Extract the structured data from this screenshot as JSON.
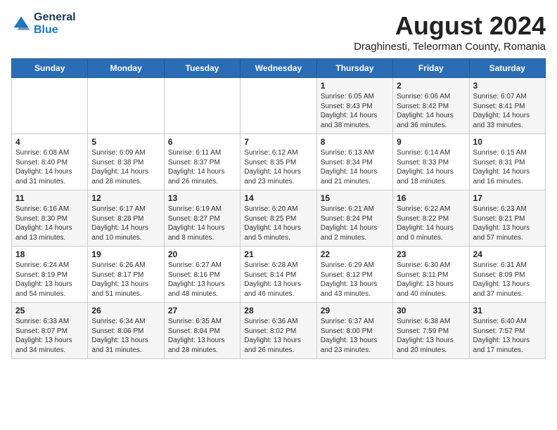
{
  "header": {
    "logo_line1": "General",
    "logo_line2": "Blue",
    "month_year": "August 2024",
    "location": "Draghinesti, Teleorman County, Romania"
  },
  "weekdays": [
    "Sunday",
    "Monday",
    "Tuesday",
    "Wednesday",
    "Thursday",
    "Friday",
    "Saturday"
  ],
  "weeks": [
    [
      {
        "day": "",
        "info": ""
      },
      {
        "day": "",
        "info": ""
      },
      {
        "day": "",
        "info": ""
      },
      {
        "day": "",
        "info": ""
      },
      {
        "day": "1",
        "info": "Sunrise: 6:05 AM\nSunset: 8:43 PM\nDaylight: 14 hours\nand 38 minutes."
      },
      {
        "day": "2",
        "info": "Sunrise: 6:06 AM\nSunset: 8:42 PM\nDaylight: 14 hours\nand 36 minutes."
      },
      {
        "day": "3",
        "info": "Sunrise: 6:07 AM\nSunset: 8:41 PM\nDaylight: 14 hours\nand 33 minutes."
      }
    ],
    [
      {
        "day": "4",
        "info": "Sunrise: 6:08 AM\nSunset: 8:40 PM\nDaylight: 14 hours\nand 31 minutes."
      },
      {
        "day": "5",
        "info": "Sunrise: 6:09 AM\nSunset: 8:38 PM\nDaylight: 14 hours\nand 28 minutes."
      },
      {
        "day": "6",
        "info": "Sunrise: 6:11 AM\nSunset: 8:37 PM\nDaylight: 14 hours\nand 26 minutes."
      },
      {
        "day": "7",
        "info": "Sunrise: 6:12 AM\nSunset: 8:35 PM\nDaylight: 14 hours\nand 23 minutes."
      },
      {
        "day": "8",
        "info": "Sunrise: 6:13 AM\nSunset: 8:34 PM\nDaylight: 14 hours\nand 21 minutes."
      },
      {
        "day": "9",
        "info": "Sunrise: 6:14 AM\nSunset: 8:33 PM\nDaylight: 14 hours\nand 18 minutes."
      },
      {
        "day": "10",
        "info": "Sunrise: 6:15 AM\nSunset: 8:31 PM\nDaylight: 14 hours\nand 16 minutes."
      }
    ],
    [
      {
        "day": "11",
        "info": "Sunrise: 6:16 AM\nSunset: 8:30 PM\nDaylight: 14 hours\nand 13 minutes."
      },
      {
        "day": "12",
        "info": "Sunrise: 6:17 AM\nSunset: 8:28 PM\nDaylight: 14 hours\nand 10 minutes."
      },
      {
        "day": "13",
        "info": "Sunrise: 6:19 AM\nSunset: 8:27 PM\nDaylight: 14 hours\nand 8 minutes."
      },
      {
        "day": "14",
        "info": "Sunrise: 6:20 AM\nSunset: 8:25 PM\nDaylight: 14 hours\nand 5 minutes."
      },
      {
        "day": "15",
        "info": "Sunrise: 6:21 AM\nSunset: 8:24 PM\nDaylight: 14 hours\nand 2 minutes."
      },
      {
        "day": "16",
        "info": "Sunrise: 6:22 AM\nSunset: 8:22 PM\nDaylight: 14 hours\nand 0 minutes."
      },
      {
        "day": "17",
        "info": "Sunrise: 6:23 AM\nSunset: 8:21 PM\nDaylight: 13 hours\nand 57 minutes."
      }
    ],
    [
      {
        "day": "18",
        "info": "Sunrise: 6:24 AM\nSunset: 8:19 PM\nDaylight: 13 hours\nand 54 minutes."
      },
      {
        "day": "19",
        "info": "Sunrise: 6:26 AM\nSunset: 8:17 PM\nDaylight: 13 hours\nand 51 minutes."
      },
      {
        "day": "20",
        "info": "Sunrise: 6:27 AM\nSunset: 8:16 PM\nDaylight: 13 hours\nand 48 minutes."
      },
      {
        "day": "21",
        "info": "Sunrise: 6:28 AM\nSunset: 8:14 PM\nDaylight: 13 hours\nand 46 minutes."
      },
      {
        "day": "22",
        "info": "Sunrise: 6:29 AM\nSunset: 8:12 PM\nDaylight: 13 hours\nand 43 minutes."
      },
      {
        "day": "23",
        "info": "Sunrise: 6:30 AM\nSunset: 8:11 PM\nDaylight: 13 hours\nand 40 minutes."
      },
      {
        "day": "24",
        "info": "Sunrise: 6:31 AM\nSunset: 8:09 PM\nDaylight: 13 hours\nand 37 minutes."
      }
    ],
    [
      {
        "day": "25",
        "info": "Sunrise: 6:33 AM\nSunset: 8:07 PM\nDaylight: 13 hours\nand 34 minutes."
      },
      {
        "day": "26",
        "info": "Sunrise: 6:34 AM\nSunset: 8:06 PM\nDaylight: 13 hours\nand 31 minutes."
      },
      {
        "day": "27",
        "info": "Sunrise: 6:35 AM\nSunset: 8:04 PM\nDaylight: 13 hours\nand 28 minutes."
      },
      {
        "day": "28",
        "info": "Sunrise: 6:36 AM\nSunset: 8:02 PM\nDaylight: 13 hours\nand 26 minutes."
      },
      {
        "day": "29",
        "info": "Sunrise: 6:37 AM\nSunset: 8:00 PM\nDaylight: 13 hours\nand 23 minutes."
      },
      {
        "day": "30",
        "info": "Sunrise: 6:38 AM\nSunset: 7:59 PM\nDaylight: 13 hours\nand 20 minutes."
      },
      {
        "day": "31",
        "info": "Sunrise: 6:40 AM\nSunset: 7:57 PM\nDaylight: 13 hours\nand 17 minutes."
      }
    ]
  ]
}
